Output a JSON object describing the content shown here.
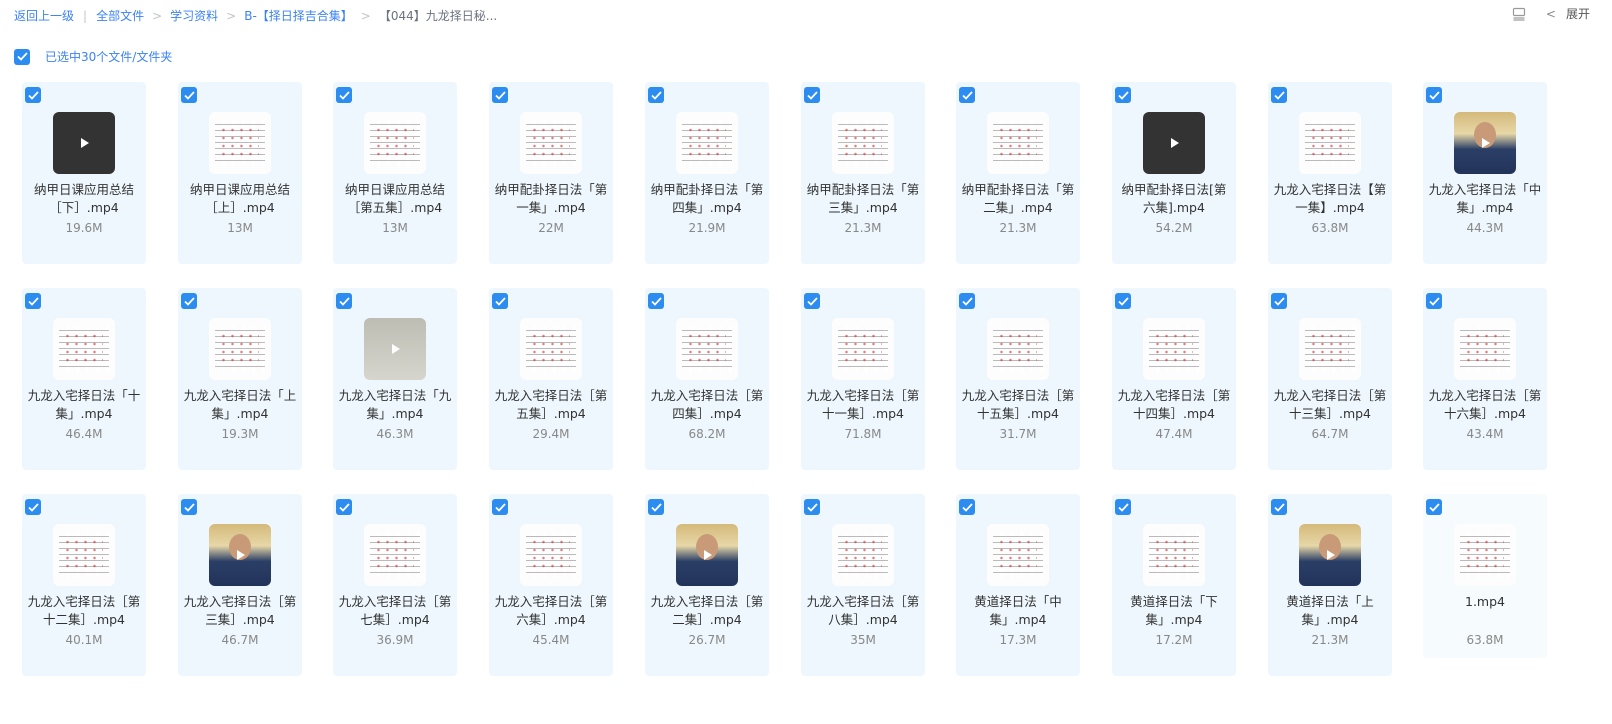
{
  "breadcrumb": {
    "back": "返回上一级",
    "items": [
      "全部文件",
      "学习资料",
      "B-【择日择吉合集】",
      "【044】九龙择日秘..."
    ]
  },
  "toolbar": {
    "expand_label": "展开"
  },
  "selection": {
    "label": "已选中30个文件/文件夹"
  },
  "colors": {
    "accent": "#2d8cf0",
    "card_bg": "#eef7fd"
  },
  "files": [
    {
      "name": "纳甲日课应用总结［下］.mp4",
      "size": "19.6M",
      "thumb": "dark",
      "play": true
    },
    {
      "name": "纳甲日课应用总结［上］.mp4",
      "size": "13M",
      "thumb": "scan",
      "play": false
    },
    {
      "name": "纳甲日课应用总结［第五集］.mp4",
      "size": "13M",
      "thumb": "scan",
      "play": false
    },
    {
      "name": "纳甲配卦择日法「第一集」.mp4",
      "size": "22M",
      "thumb": "scan",
      "play": false
    },
    {
      "name": "纳甲配卦择日法「第四集」.mp4",
      "size": "21.9M",
      "thumb": "scan",
      "play": false
    },
    {
      "name": "纳甲配卦择日法「第三集」.mp4",
      "size": "21.3M",
      "thumb": "scan",
      "play": false
    },
    {
      "name": "纳甲配卦择日法「第二集」.mp4",
      "size": "21.3M",
      "thumb": "scan",
      "play": false
    },
    {
      "name": "纳甲配卦择日法[第六集].mp4",
      "size": "54.2M",
      "thumb": "dark",
      "play": true
    },
    {
      "name": "九龙入宅择日法【第一集】.mp4",
      "size": "63.8M",
      "thumb": "scan",
      "play": false
    },
    {
      "name": "九龙入宅择日法「中集」.mp4",
      "size": "44.3M",
      "thumb": "photo",
      "play": true
    },
    {
      "name": "九龙入宅择日法「十集」.mp4",
      "size": "46.4M",
      "thumb": "scan",
      "play": false
    },
    {
      "name": "九龙入宅择日法「上集」.mp4",
      "size": "19.3M",
      "thumb": "scan",
      "play": false
    },
    {
      "name": "九龙入宅择日法「九集」.mp4",
      "size": "46.3M",
      "thumb": "gray",
      "play": true
    },
    {
      "name": "九龙入宅择日法［第五集］.mp4",
      "size": "29.4M",
      "thumb": "scan",
      "play": false
    },
    {
      "name": "九龙入宅择日法［第四集］.mp4",
      "size": "68.2M",
      "thumb": "scan",
      "play": false
    },
    {
      "name": "九龙入宅择日法［第十一集］.mp4",
      "size": "71.8M",
      "thumb": "scan",
      "play": false
    },
    {
      "name": "九龙入宅择日法［第十五集］.mp4",
      "size": "31.7M",
      "thumb": "scan",
      "play": false
    },
    {
      "name": "九龙入宅择日法［第十四集］.mp4",
      "size": "47.4M",
      "thumb": "scan",
      "play": false
    },
    {
      "name": "九龙入宅择日法［第十三集］.mp4",
      "size": "64.7M",
      "thumb": "scan",
      "play": false
    },
    {
      "name": "九龙入宅择日法［第十六集］.mp4",
      "size": "43.4M",
      "thumb": "scan",
      "play": false
    },
    {
      "name": "九龙入宅择日法［第十二集］.mp4",
      "size": "40.1M",
      "thumb": "scan",
      "play": false
    },
    {
      "name": "九龙入宅择日法［第三集］.mp4",
      "size": "46.7M",
      "thumb": "photo",
      "play": true
    },
    {
      "name": "九龙入宅择日法［第七集］.mp4",
      "size": "36.9M",
      "thumb": "scan",
      "play": false
    },
    {
      "name": "九龙入宅择日法［第六集］.mp4",
      "size": "45.4M",
      "thumb": "scan",
      "play": false
    },
    {
      "name": "九龙入宅择日法［第二集］.mp4",
      "size": "26.7M",
      "thumb": "photo",
      "play": true
    },
    {
      "name": "九龙入宅择日法［第八集］.mp4",
      "size": "35M",
      "thumb": "scan",
      "play": false
    },
    {
      "name": "黄道择日法「中集」.mp4",
      "size": "17.3M",
      "thumb": "scan",
      "play": false
    },
    {
      "name": "黄道择日法「下集」.mp4",
      "size": "17.2M",
      "thumb": "scan",
      "play": false
    },
    {
      "name": "黄道择日法「上集」.mp4",
      "size": "21.3M",
      "thumb": "photo",
      "play": true
    },
    {
      "name": "1.mp4",
      "size": "63.8M",
      "thumb": "scan",
      "play": false
    }
  ]
}
